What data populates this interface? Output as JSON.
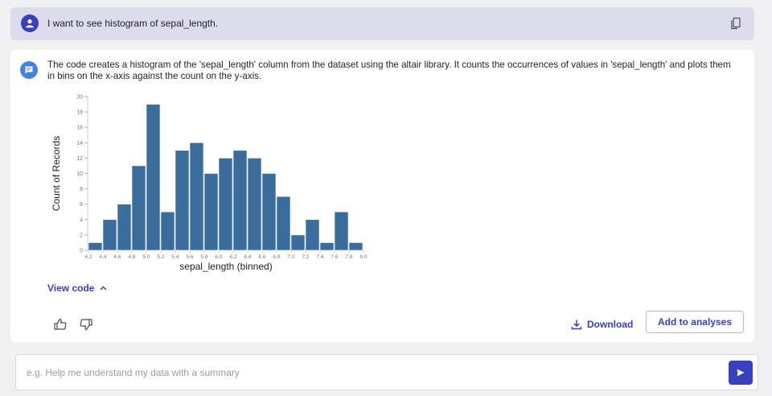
{
  "user_message": {
    "text": "I want to see histogram of sepal_length."
  },
  "assistant_reply": {
    "text": "The code creates a histogram of the 'sepal_length' column from the dataset using the altair library. It counts the occurrences of values in 'sepal_length' and plots them in bins on the x-axis against the count on the y-axis.",
    "view_code_label": "View code",
    "download_label": "Download",
    "add_to_analyses_label": "Add to analyses"
  },
  "chart_data": {
    "type": "bar",
    "title": "",
    "xlabel": "sepal_length (binned)",
    "ylabel": "Count of Records",
    "x_ticks": [
      "4.2",
      "4.4",
      "4.6",
      "4.8",
      "5.0",
      "5.2",
      "5.4",
      "5.6",
      "5.8",
      "6.0",
      "6.2",
      "6.4",
      "6.6",
      "6.8",
      "7.0",
      "7.2",
      "7.4",
      "7.6",
      "7.8",
      "8.0"
    ],
    "bins": [
      {
        "start": 4.2,
        "end": 4.4,
        "count": 1
      },
      {
        "start": 4.4,
        "end": 4.6,
        "count": 4
      },
      {
        "start": 4.6,
        "end": 4.8,
        "count": 6
      },
      {
        "start": 4.8,
        "end": 5.0,
        "count": 11
      },
      {
        "start": 5.0,
        "end": 5.2,
        "count": 19
      },
      {
        "start": 5.2,
        "end": 5.4,
        "count": 5
      },
      {
        "start": 5.4,
        "end": 5.6,
        "count": 13
      },
      {
        "start": 5.6,
        "end": 5.8,
        "count": 14
      },
      {
        "start": 5.8,
        "end": 6.0,
        "count": 10
      },
      {
        "start": 6.0,
        "end": 6.2,
        "count": 12
      },
      {
        "start": 6.2,
        "end": 6.4,
        "count": 13
      },
      {
        "start": 6.4,
        "end": 6.6,
        "count": 12
      },
      {
        "start": 6.6,
        "end": 6.8,
        "count": 10
      },
      {
        "start": 6.8,
        "end": 7.0,
        "count": 7
      },
      {
        "start": 7.0,
        "end": 7.2,
        "count": 2
      },
      {
        "start": 7.2,
        "end": 7.4,
        "count": 4
      },
      {
        "start": 7.4,
        "end": 7.6,
        "count": 1
      },
      {
        "start": 7.6,
        "end": 7.8,
        "count": 5
      },
      {
        "start": 7.8,
        "end": 8.0,
        "count": 1
      }
    ],
    "ylim": [
      0,
      20
    ],
    "y_ticks": [
      0,
      2,
      4,
      6,
      8,
      10,
      12,
      14,
      16,
      18,
      20
    ],
    "bar_color": "#3b6d9c",
    "grid": false
  },
  "input": {
    "placeholder": "e.g. Help me understand my data with a summary",
    "value": ""
  },
  "colors": {
    "accent": "#3a3fc0",
    "user_bubble": "#dcdcec",
    "bot_icon": "#3f83e6"
  },
  "icons": {
    "user": "user-avatar-icon",
    "bot": "chat-bubble-icon",
    "copy": "copy-icon",
    "chevron": "chevron-up-icon",
    "thumbs_up": "thumbs-up-icon",
    "thumbs_down": "thumbs-down-icon",
    "download": "download-icon",
    "send": "send-icon"
  }
}
